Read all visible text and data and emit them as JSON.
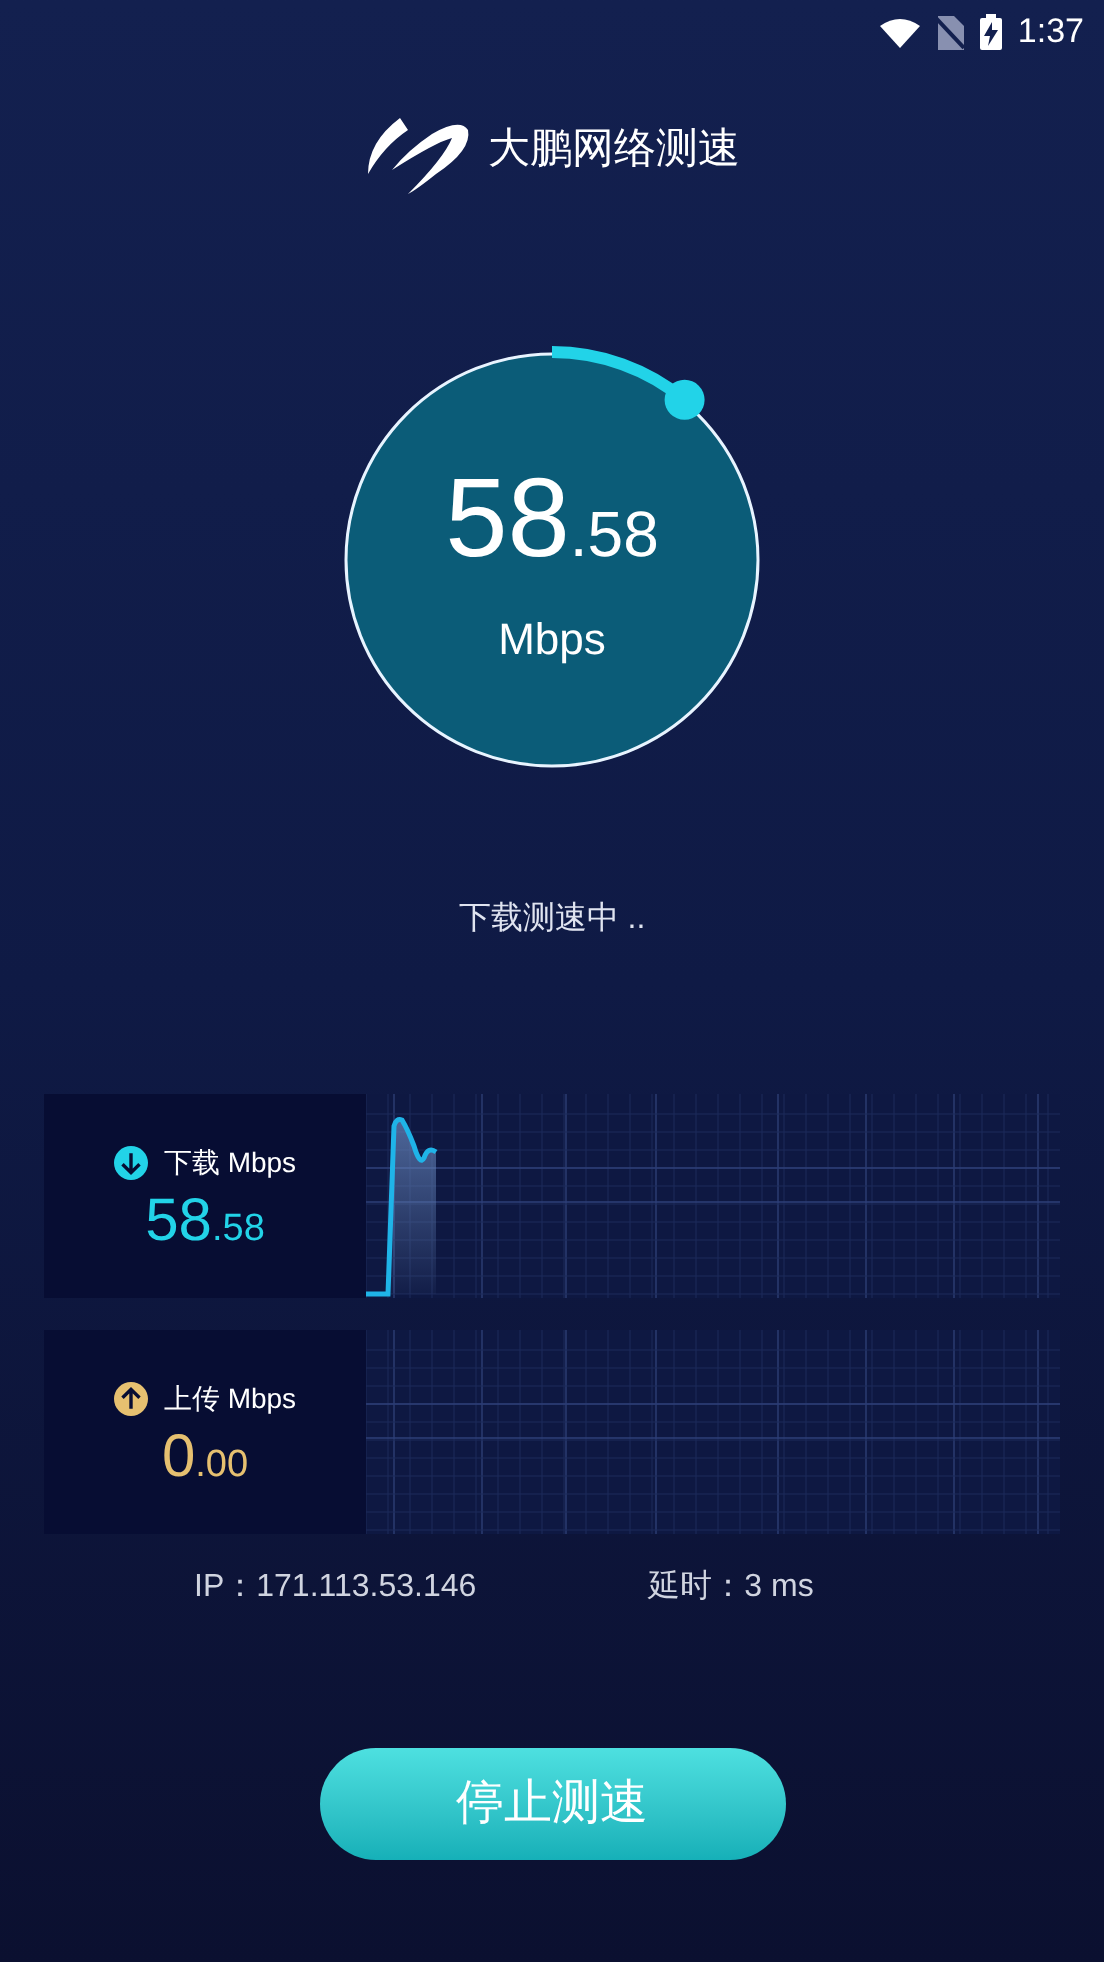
{
  "status_bar": {
    "time": "1:37"
  },
  "app_title": "大鹏网络测速",
  "gauge": {
    "integer": "58",
    "fraction": ".58",
    "unit": "Mbps"
  },
  "status_text": "下载测速中 ..",
  "panels": [
    {
      "kind": "download",
      "label": "下载 Mbps",
      "integer": "58",
      "fraction": ".58"
    },
    {
      "kind": "upload",
      "label": "上传 Mbps",
      "integer": "0",
      "fraction": ".00"
    }
  ],
  "ip": "IP：171.113.53.146",
  "latency": "延时：3 ms",
  "stop_button": "停止测速"
}
